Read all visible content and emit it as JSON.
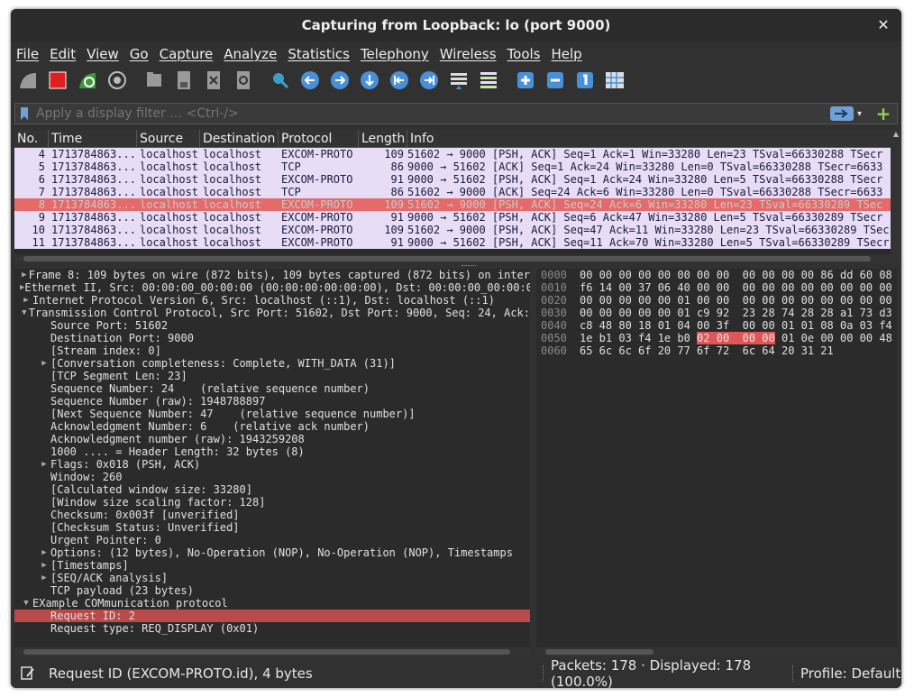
{
  "window": {
    "title": "Capturing from Loopback: lo (port 9000)",
    "close_glyph": "✕"
  },
  "menu": [
    "File",
    "Edit",
    "View",
    "Go",
    "Capture",
    "Analyze",
    "Statistics",
    "Telephony",
    "Wireless",
    "Tools",
    "Help"
  ],
  "toolbar": {
    "icons": [
      "start-capture-icon",
      "stop-capture-icon",
      "restart-capture-icon",
      "capture-options-icon",
      "open-file-icon",
      "save-file-icon",
      "close-file-icon",
      "reload-file-icon",
      "find-packet-icon",
      "go-back-icon",
      "go-forward-icon",
      "go-to-packet-icon",
      "first-packet-icon",
      "last-packet-icon",
      "autoscroll-icon",
      "colorize-icon",
      "zoom-in-icon",
      "zoom-out-icon",
      "normal-size-icon",
      "resize-columns-icon"
    ]
  },
  "filter": {
    "placeholder": "Apply a display filter … <Ctrl-/>",
    "add_glyph": "+",
    "dropdown_glyph": "▾"
  },
  "packet_list": {
    "columns": [
      "No.",
      "Time",
      "Source",
      "Destination",
      "Protocol",
      "Length",
      "Info"
    ],
    "rows": [
      {
        "no": "4",
        "time": "1713784863...",
        "src": "localhost",
        "dst": "localhost",
        "proto": "EXCOM-PROTO",
        "len": "109",
        "info": "51602 → 9000 [PSH, ACK] Seq=1 Ack=1 Win=33280 Len=23 TSval=66330288 TSecr",
        "selected": false
      },
      {
        "no": "5",
        "time": "1713784863...",
        "src": "localhost",
        "dst": "localhost",
        "proto": "TCP",
        "len": "86",
        "info": "9000 → 51602 [ACK] Seq=1 Ack=24 Win=33280 Len=0 TSval=66330288 TSecr=6633",
        "selected": false
      },
      {
        "no": "6",
        "time": "1713784863...",
        "src": "localhost",
        "dst": "localhost",
        "proto": "EXCOM-PROTO",
        "len": "91",
        "info": "9000 → 51602 [PSH, ACK] Seq=1 Ack=24 Win=33280 Len=5 TSval=66330288 TSecr",
        "selected": false
      },
      {
        "no": "7",
        "time": "1713784863...",
        "src": "localhost",
        "dst": "localhost",
        "proto": "TCP",
        "len": "86",
        "info": "51602 → 9000 [ACK] Seq=24 Ack=6 Win=33280 Len=0 TSval=66330288 TSecr=6633",
        "selected": false
      },
      {
        "no": "8",
        "time": "1713784863...",
        "src": "localhost",
        "dst": "localhost",
        "proto": "EXCOM-PROTO",
        "len": "109",
        "info": "51602 → 9000 [PSH, ACK] Seq=24 Ack=6 Win=33280 Len=23 TSval=66330289 TSec",
        "selected": true
      },
      {
        "no": "9",
        "time": "1713784863...",
        "src": "localhost",
        "dst": "localhost",
        "proto": "EXCOM-PROTO",
        "len": "91",
        "info": "9000 → 51602 [PSH, ACK] Seq=6 Ack=47 Win=33280 Len=5 TSval=66330289 TSecr",
        "selected": false
      },
      {
        "no": "10",
        "time": "1713784863...",
        "src": "localhost",
        "dst": "localhost",
        "proto": "EXCOM-PROTO",
        "len": "109",
        "info": "51602 → 9000 [PSH, ACK] Seq=47 Ack=11 Win=33280 Len=23 TSval=66330289 TSec",
        "selected": false
      },
      {
        "no": "11",
        "time": "1713784863...",
        "src": "localhost",
        "dst": "localhost",
        "proto": "EXCOM-PROTO",
        "len": "91",
        "info": "9000 → 51602 [PSH, ACK] Seq=11 Ack=70 Win=33280 Len=5 TSval=66330289 TSecr",
        "selected": false
      }
    ]
  },
  "details": [
    {
      "indent": 0,
      "arrow": "right",
      "text": "Frame 8: 109 bytes on wire (872 bits), 109 bytes captured (872 bits) on inter",
      "selected": false
    },
    {
      "indent": 0,
      "arrow": "right",
      "text": "Ethernet II, Src: 00:00:00_00:00:00 (00:00:00:00:00:00), Dst: 00:00:00_00:00:0",
      "selected": false
    },
    {
      "indent": 0,
      "arrow": "right",
      "text": "Internet Protocol Version 6, Src: localhost (::1), Dst: localhost (::1)",
      "selected": false
    },
    {
      "indent": 0,
      "arrow": "down",
      "text": "Transmission Control Protocol, Src Port: 51602, Dst Port: 9000, Seq: 24, Ack:",
      "selected": false
    },
    {
      "indent": 1,
      "arrow": "",
      "text": "Source Port: 51602",
      "selected": false
    },
    {
      "indent": 1,
      "arrow": "",
      "text": "Destination Port: 9000",
      "selected": false
    },
    {
      "indent": 1,
      "arrow": "",
      "text": "[Stream index: 0]",
      "selected": false
    },
    {
      "indent": 1,
      "arrow": "right",
      "text": "[Conversation completeness: Complete, WITH_DATA (31)]",
      "selected": false
    },
    {
      "indent": 1,
      "arrow": "",
      "text": "[TCP Segment Len: 23]",
      "selected": false
    },
    {
      "indent": 1,
      "arrow": "",
      "text": "Sequence Number: 24    (relative sequence number)",
      "selected": false
    },
    {
      "indent": 1,
      "arrow": "",
      "text": "Sequence Number (raw): 1948788897",
      "selected": false
    },
    {
      "indent": 1,
      "arrow": "",
      "text": "[Next Sequence Number: 47    (relative sequence number)]",
      "selected": false
    },
    {
      "indent": 1,
      "arrow": "",
      "text": "Acknowledgment Number: 6    (relative ack number)",
      "selected": false
    },
    {
      "indent": 1,
      "arrow": "",
      "text": "Acknowledgment number (raw): 1943259208",
      "selected": false
    },
    {
      "indent": 1,
      "arrow": "",
      "text": "1000 .... = Header Length: 32 bytes (8)",
      "selected": false
    },
    {
      "indent": 1,
      "arrow": "right",
      "text": "Flags: 0x018 (PSH, ACK)",
      "selected": false
    },
    {
      "indent": 1,
      "arrow": "",
      "text": "Window: 260",
      "selected": false
    },
    {
      "indent": 1,
      "arrow": "",
      "text": "[Calculated window size: 33280]",
      "selected": false
    },
    {
      "indent": 1,
      "arrow": "",
      "text": "[Window size scaling factor: 128]",
      "selected": false
    },
    {
      "indent": 1,
      "arrow": "",
      "text": "Checksum: 0x003f [unverified]",
      "selected": false
    },
    {
      "indent": 1,
      "arrow": "",
      "text": "[Checksum Status: Unverified]",
      "selected": false
    },
    {
      "indent": 1,
      "arrow": "",
      "text": "Urgent Pointer: 0",
      "selected": false
    },
    {
      "indent": 1,
      "arrow": "right",
      "text": "Options: (12 bytes), No-Operation (NOP), No-Operation (NOP), Timestamps",
      "selected": false
    },
    {
      "indent": 1,
      "arrow": "right",
      "text": "[Timestamps]",
      "selected": false
    },
    {
      "indent": 1,
      "arrow": "right",
      "text": "[SEQ/ACK analysis]",
      "selected": false
    },
    {
      "indent": 1,
      "arrow": "",
      "text": "TCP payload (23 bytes)",
      "selected": false
    },
    {
      "indent": 0,
      "arrow": "down",
      "text": "EXample COMmunication protocol",
      "selected": false
    },
    {
      "indent": 1,
      "arrow": "",
      "text": "Request ID: 2",
      "selected": true
    },
    {
      "indent": 1,
      "arrow": "",
      "text": "Request type: REQ_DISPLAY (0x01)",
      "selected": false
    }
  ],
  "hex": [
    {
      "offset": "0000",
      "pre": "00 00 00 00 00 00 00 00  00 00 00 00 86 dd 60 08",
      "hl": "",
      "post": ""
    },
    {
      "offset": "0010",
      "pre": "f6 14 00 37 06 40 00 00  00 00 00 00 00 00 00 00",
      "hl": "",
      "post": ""
    },
    {
      "offset": "0020",
      "pre": "00 00 00 00 00 01 00 00  00 00 00 00 00 00 00 00",
      "hl": "",
      "post": ""
    },
    {
      "offset": "0030",
      "pre": "00 00 00 00 00 01 c9 92  23 28 74 28 28 a1 73 d3",
      "hl": "",
      "post": ""
    },
    {
      "offset": "0040",
      "pre": "c8 48 80 18 01 04 00 3f  00 00 01 01 08 0a 03 f4",
      "hl": "",
      "post": ""
    },
    {
      "offset": "0050",
      "pre": "1e b1 03 f4 1e b0 ",
      "hl": "02 00  00 00",
      "post": " 01 0e 00 00 00 48"
    },
    {
      "offset": "0060",
      "pre": "65 6c 6c 6f 20 77 6f 72  6c 64 20 31 21",
      "hl": "",
      "post": ""
    }
  ],
  "status": {
    "field": "Request ID (EXCOM-PROTO.id), 4 bytes",
    "packets": "Packets: 178 · Displayed: 178 (100.0%)",
    "profile": "Profile: Default"
  },
  "colors": {
    "selected_row": "#e56a6a",
    "tcp_row": "#e8ddf7",
    "selected_tree": "#b84a4a",
    "hex_highlight": "#e05555"
  }
}
